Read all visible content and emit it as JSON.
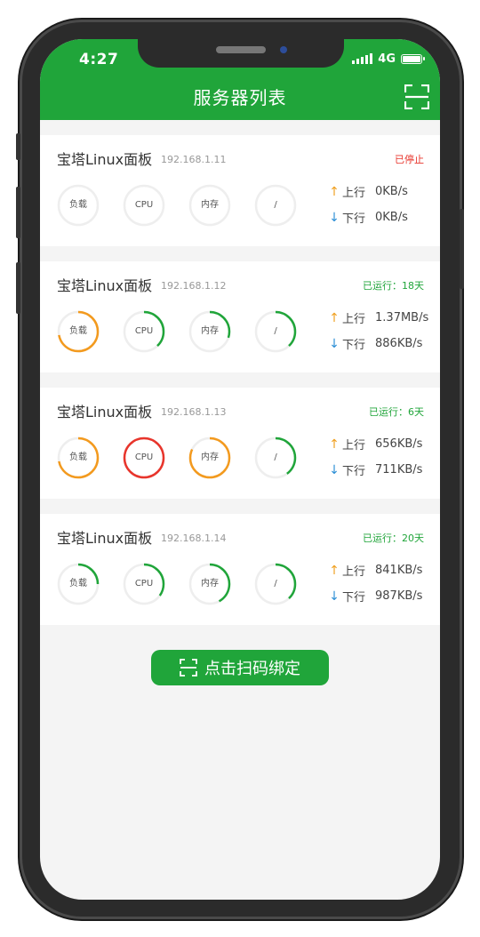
{
  "status_bar": {
    "time": "4:27",
    "network": "4G"
  },
  "header": {
    "title": "服务器列表",
    "scan_icon": "scan-icon"
  },
  "colors": {
    "brand": "#20a53a",
    "normal": "#20a53a",
    "warning": "#f39a1e",
    "danger": "#e8352c",
    "stopped": "#e8352c",
    "track": "#eeeeee"
  },
  "gauge_labels": [
    "负载",
    "CPU",
    "内存",
    "/"
  ],
  "traffic_labels": {
    "up": "上行",
    "down": "下行"
  },
  "servers": [
    {
      "name": "宝塔Linux面板",
      "ip": "192.168.1.11",
      "status": "已停止",
      "status_color": "#e8352c",
      "gauges": [
        {
          "percent": 0,
          "color": "#eeeeee"
        },
        {
          "percent": 0,
          "color": "#eeeeee"
        },
        {
          "percent": 0,
          "color": "#eeeeee"
        },
        {
          "percent": 0,
          "color": "#eeeeee"
        }
      ],
      "up": "0KB/s",
      "down": "0KB/s"
    },
    {
      "name": "宝塔Linux面板",
      "ip": "192.168.1.12",
      "status": "已运行：18天",
      "status_color": "#20a53a",
      "gauges": [
        {
          "percent": 72,
          "color": "#f39a1e"
        },
        {
          "percent": 38,
          "color": "#20a53a"
        },
        {
          "percent": 30,
          "color": "#20a53a"
        },
        {
          "percent": 38,
          "color": "#20a53a"
        }
      ],
      "up": "1.37MB/s",
      "down": "886KB/s"
    },
    {
      "name": "宝塔Linux面板",
      "ip": "192.168.1.13",
      "status": "已运行：6天",
      "status_color": "#20a53a",
      "gauges": [
        {
          "percent": 72,
          "color": "#f39a1e"
        },
        {
          "percent": 100,
          "color": "#e8352c"
        },
        {
          "percent": 82,
          "color": "#f39a1e"
        },
        {
          "percent": 40,
          "color": "#20a53a"
        }
      ],
      "up": "656KB/s",
      "down": "711KB/s"
    },
    {
      "name": "宝塔Linux面板",
      "ip": "192.168.1.14",
      "status": "已运行：20天",
      "status_color": "#20a53a",
      "gauges": [
        {
          "percent": 25,
          "color": "#20a53a"
        },
        {
          "percent": 35,
          "color": "#20a53a"
        },
        {
          "percent": 42,
          "color": "#20a53a"
        },
        {
          "percent": 38,
          "color": "#20a53a"
        }
      ],
      "up": "841KB/s",
      "down": "987KB/s"
    }
  ],
  "bind_button": {
    "label": "点击扫码绑定",
    "icon": "scan-icon"
  }
}
